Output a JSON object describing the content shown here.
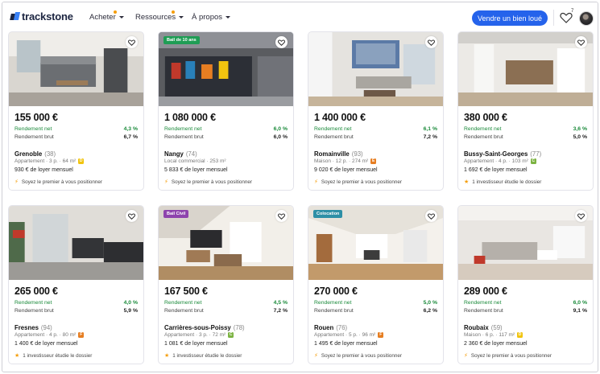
{
  "header": {
    "logo_text": "trackstone",
    "nav": [
      {
        "label": "Acheter",
        "dot": true
      },
      {
        "label": "Ressources",
        "dot": true
      },
      {
        "label": "À propos",
        "dot": false
      }
    ],
    "cta_label": "Vendre un bien loué",
    "favorites_count": "7"
  },
  "labels": {
    "net": "Rendement net",
    "brut": "Rendement brut"
  },
  "colors": {
    "accent": "#2563eb",
    "net_green": "#1a8a3a",
    "star": "#f59e0b"
  },
  "cards": [
    {
      "price": "155 000 €",
      "net": "4,3 %",
      "brut": "6,7 %",
      "city": "Grenoble",
      "dep": "(38)",
      "desc": "Appartement · 3 p. · 64 m²",
      "dpe": "D",
      "dpe_color": "#f1c40f",
      "rent": "930 € de loyer mensuel",
      "foot": "Soyez le premier à vous positionner",
      "foot_icon": "bolt-icon",
      "badge": ""
    },
    {
      "price": "1 080 000 €",
      "net": "6,0 %",
      "brut": "6,0 %",
      "city": "Nangy",
      "dep": "(74)",
      "desc": "Local commercial · 253 m²",
      "dpe": "",
      "dpe_color": "",
      "rent": "5 833 € de loyer mensuel",
      "foot": "Soyez le premier à vous positionner",
      "foot_icon": "bolt-icon",
      "badge": "Bail de 10 ans",
      "badge_color": "#1f9d55"
    },
    {
      "price": "1 400 000 €",
      "net": "6,1 %",
      "brut": "7,2 %",
      "city": "Romainville",
      "dep": "(93)",
      "desc": "Maison · 12 p. · 274 m²",
      "dpe": "E",
      "dpe_color": "#e67e22",
      "rent": "9 020 € de loyer mensuel",
      "foot": "Soyez le premier à vous positionner",
      "foot_icon": "bolt-icon",
      "badge": ""
    },
    {
      "price": "380 000 €",
      "net": "3,6 %",
      "brut": "5,0 %",
      "city": "Bussy-Saint-Georges",
      "dep": "(77)",
      "desc": "Appartement · 4 p. · 103 m²",
      "dpe": "C",
      "dpe_color": "#7cb342",
      "rent": "1 692 € de loyer mensuel",
      "foot": "1 investisseur étudie le dossier",
      "foot_icon": "star-icon",
      "badge": ""
    },
    {
      "price": "265 000 €",
      "net": "4,0 %",
      "brut": "5,9 %",
      "city": "Fresnes",
      "dep": "(94)",
      "desc": "Appartement · 4 p. · 80 m²",
      "dpe": "F",
      "dpe_color": "#e67e22",
      "rent": "1 400 € de loyer mensuel",
      "foot": "1 investisseur étudie le dossier",
      "foot_icon": "star-icon",
      "badge": ""
    },
    {
      "price": "167 500 €",
      "net": "4,5 %",
      "brut": "7,2 %",
      "city": "Carrières-sous-Poissy",
      "dep": "(78)",
      "desc": "Appartement · 3 p. · 72 m²",
      "dpe": "C",
      "dpe_color": "#7cb342",
      "rent": "1 081 € de loyer mensuel",
      "foot": "1 investisseur étudie le dossier",
      "foot_icon": "star-icon",
      "badge": "Bail Civil",
      "badge_color": "#8e44ad"
    },
    {
      "price": "270 000 €",
      "net": "5,0 %",
      "brut": "6,2 %",
      "city": "Rouen",
      "dep": "(76)",
      "desc": "Appartement · 5 p. · 96 m²",
      "dpe": "F",
      "dpe_color": "#e67e22",
      "rent": "1 495 € de loyer mensuel",
      "foot": "Soyez le premier à vous positionner",
      "foot_icon": "bolt-icon",
      "badge": "Colocation",
      "badge_color": "#2d8fa6"
    },
    {
      "price": "289 000 €",
      "net": "6,0 %",
      "brut": "9,1 %",
      "city": "Roubaix",
      "dep": "(59)",
      "desc": "Maison · 6 p. · 117 m²",
      "dpe": "D",
      "dpe_color": "#f1c40f",
      "rent": "2 360 € de loyer mensuel",
      "foot": "Soyez le premier à vous positionner",
      "foot_icon": "bolt-icon",
      "badge": ""
    }
  ]
}
